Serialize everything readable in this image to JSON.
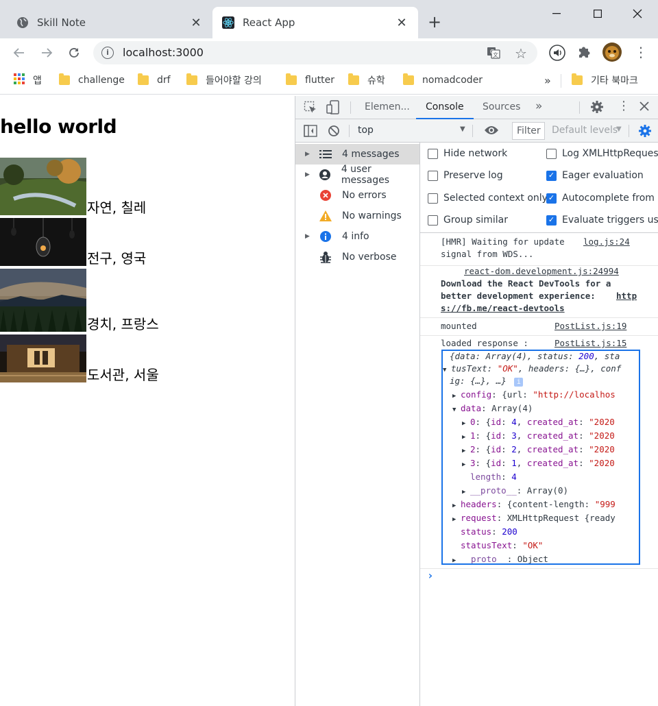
{
  "browser": {
    "tabs": [
      {
        "title": "Skill Note",
        "icon": "globe-icon",
        "active": false
      },
      {
        "title": "React App",
        "icon": "react-icon",
        "active": true
      }
    ],
    "url": "localhost:3000",
    "bookmarks": [
      {
        "label": "앱",
        "icon": "apps-grid-icon"
      },
      {
        "label": "challenge"
      },
      {
        "label": "drf"
      },
      {
        "label": "들어야할 강의"
      },
      {
        "label": "flutter"
      },
      {
        "label": "슈학"
      },
      {
        "label": "nomadcoder"
      }
    ],
    "bookmarks_overflow": "»",
    "other_bookmarks": "기타 북마크"
  },
  "page": {
    "heading": "hello world",
    "posts": [
      {
        "caption": "자연, 칠레"
      },
      {
        "caption": "전구, 영국"
      },
      {
        "caption": "경치, 프랑스"
      },
      {
        "caption": "도서관, 서울"
      }
    ]
  },
  "devtools": {
    "tabs": [
      "Elemen...",
      "Console",
      "Sources"
    ],
    "active_tab": "Console",
    "more": "»",
    "context": "top",
    "filter_placeholder": "Filter",
    "levels": "Default levels",
    "sidebar": [
      {
        "label": "4 messages",
        "icon": "list-icon",
        "expandable": true,
        "selected": true
      },
      {
        "label": "4 user messages",
        "icon": "user-icon",
        "expandable": true
      },
      {
        "label": "No errors",
        "icon": "error-icon",
        "expandable": false
      },
      {
        "label": "No warnings",
        "icon": "warning-icon",
        "expandable": false
      },
      {
        "label": "4 info",
        "icon": "info-icon",
        "expandable": true
      },
      {
        "label": "No verbose",
        "icon": "bug-icon",
        "expandable": false
      }
    ],
    "settings": [
      {
        "label": "Hide network",
        "checked": false
      },
      {
        "label": "Log XMLHttpRequest",
        "checked": false
      },
      {
        "label": "Preserve log",
        "checked": false
      },
      {
        "label": "Eager evaluation",
        "checked": true
      },
      {
        "label": "Selected context only",
        "checked": false
      },
      {
        "label": "Autocomplete from h",
        "checked": true
      },
      {
        "label": "Group similar",
        "checked": false
      },
      {
        "label": "Evaluate triggers user",
        "checked": true
      }
    ],
    "messages": {
      "hmr_line1": "[HMR] Waiting for update",
      "hmr_line2": "signal from WDS...",
      "hmr_source": "log.js:24",
      "react_source": "react-dom.development.js:24994",
      "react_line1": "Download the React DevTools for a",
      "react_line2": "better development experience: ",
      "react_link1": "http",
      "react_link2": "s://fb.me/react-devtools",
      "mounted": "mounted",
      "mounted_source": "PostList.js:19",
      "loaded": "loaded response :",
      "loaded_source": "PostList.js:15"
    },
    "object": {
      "summary1a": "{data: Array(4), status: ",
      "summary1b": "200",
      "summary1c": ", sta",
      "summary2a": "tusText: ",
      "summary2b": "\"OK\"",
      "summary2c": ", headers: {…}, conf",
      "summary3": "ig: {…}, …}",
      "config_key": "config",
      "config_val": ": {url: ",
      "config_str": "\"http://localhos",
      "data_key": "data",
      "data_val": ": Array(4)",
      "items": [
        {
          "idx": "0",
          "id": "4",
          "created": "\"2020"
        },
        {
          "idx": "1",
          "id": "3",
          "created": "\"2020"
        },
        {
          "idx": "2",
          "id": "2",
          "created": "\"2020"
        },
        {
          "idx": "3",
          "id": "1",
          "created": "\"2020"
        }
      ],
      "length_key": "length",
      "length_val": "4",
      "proto_key": "__proto__",
      "proto_val": ": Array(0)",
      "headers_key": "headers",
      "headers_val": ": {content-length: ",
      "headers_str": "\"999",
      "request_key": "request",
      "request_val": ": XMLHttpRequest {ready",
      "status_key": "status",
      "status_val": "200",
      "statustext_key": "statusText",
      "statustext_val": "\"OK\"",
      "proto2_key": "__proto__",
      "proto2_val": ": Object"
    },
    "prompt": "›"
  }
}
